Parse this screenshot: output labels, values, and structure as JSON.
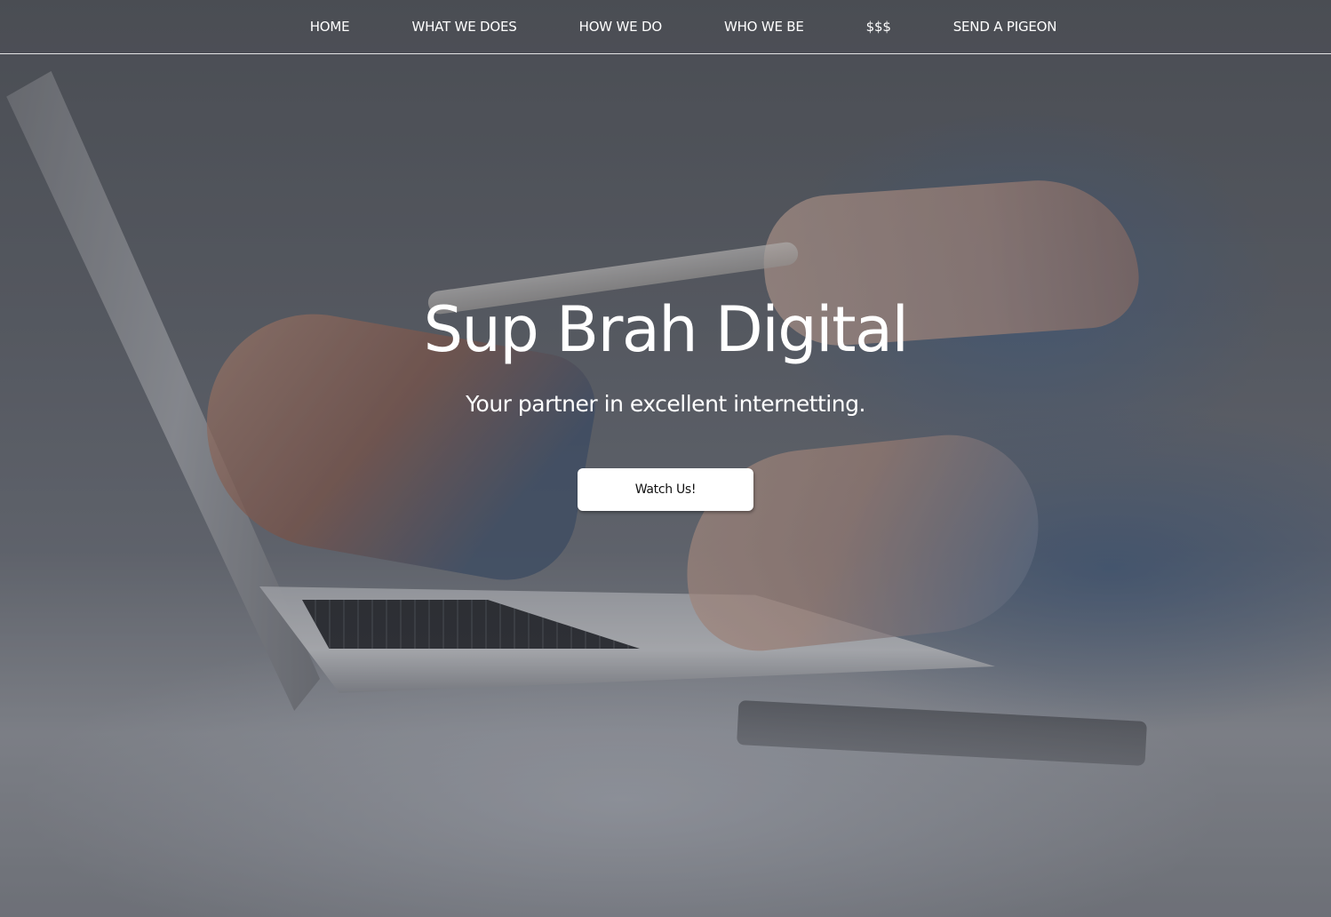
{
  "nav": {
    "items": [
      {
        "label": "HOME"
      },
      {
        "label": "WHAT WE DOES"
      },
      {
        "label": "HOW WE DO"
      },
      {
        "label": "WHO WE BE"
      },
      {
        "label": "$$$"
      },
      {
        "label": "SEND A PIGEON"
      }
    ]
  },
  "hero": {
    "title": "Sup Brah Digital",
    "subtitle": "Your partner in excellent internetting.",
    "cta_label": "Watch Us!",
    "background_image": "laptop-desk-hands-photo"
  },
  "colors": {
    "text": "#ffffff",
    "button_bg": "#ffffff",
    "button_text": "#111111",
    "nav_divider": "#ffffff"
  }
}
